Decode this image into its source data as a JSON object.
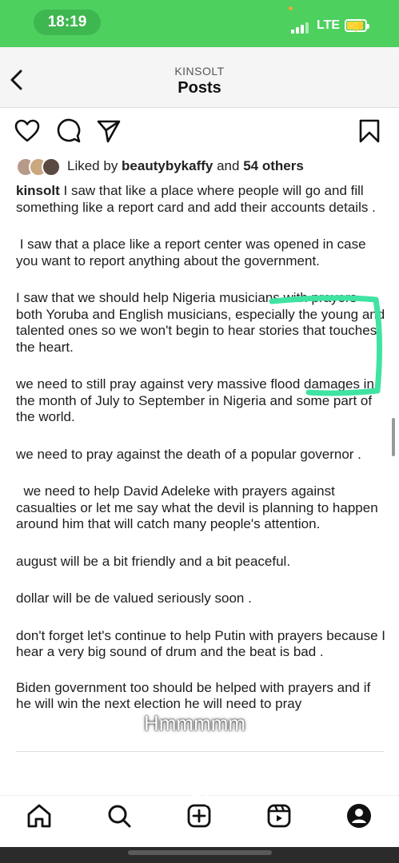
{
  "status_bar": {
    "time": "18:19",
    "network": "LTE",
    "accent_color": "#4dd05e"
  },
  "header": {
    "username": "KINSOLT",
    "title": "Posts",
    "back_icon": "chevron-left-icon"
  },
  "actions": {
    "like_icon": "heart-icon",
    "comment_icon": "comment-icon",
    "share_icon": "send-icon",
    "save_icon": "bookmark-icon"
  },
  "likes": {
    "prefix": "Liked by ",
    "user": "beautybykaffy",
    "middle": " and ",
    "others": "54 others"
  },
  "caption": {
    "username": "kinsolt",
    "paragraphs": [
      " I saw that like a place where people will go and fill something like a report card and add their accounts details .",
      " I saw that a place like a report center was opened in case you want to report anything about the government.",
      "I saw that we should help Nigeria musicians with prayers both Yoruba and English musicians, especially the young and talented ones so we won't begin to hear stories that touches the heart.",
      "we need to still pray against very massive flood damages in the month of July to September in Nigeria and some part of the world.",
      "we need to pray against the death of a popular governor .",
      "  we need to help David Adeleke with prayers against casualties or let me say what the devil is planning to happen around him that will catch many people's attention.",
      "august will be a bit friendly and a bit peaceful.",
      "dollar will be de valued seriously soon .",
      "don't forget let's continue to help Putin with prayers because I hear a very big sound of drum and the beat is bad .",
      "Biden government too should be helped with prayers and if he will win the next election he will need to pray"
    ]
  },
  "overlay": {
    "text": "Hmmmmm",
    "annotation_color": "#3fe3a2"
  },
  "tab_bar": {
    "items": [
      "home-icon",
      "search-icon",
      "create-icon",
      "reels-icon",
      "profile-icon"
    ]
  }
}
